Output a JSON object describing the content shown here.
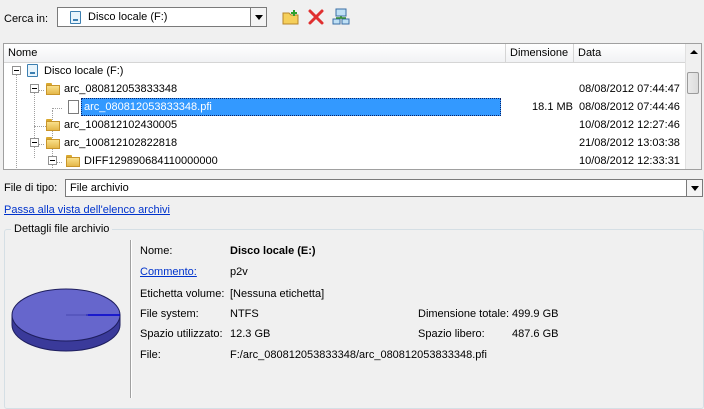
{
  "top": {
    "look_in_label": "Cerca in:",
    "location": "Disco locale (F:)",
    "toolbar": [
      "new-folder-icon",
      "delete-icon",
      "network-icon"
    ]
  },
  "list": {
    "columns": [
      "Nome",
      "Dimensione",
      "Data"
    ],
    "rows": [
      {
        "name": "Disco locale (F:)",
        "size": "",
        "date": "",
        "kind": "drive",
        "selected": false
      },
      {
        "name": "arc_080812053833348",
        "size": "",
        "date": "08/08/2012 07:44:47",
        "kind": "folder",
        "selected": false
      },
      {
        "name": "arc_080812053833348.pfi",
        "size": "18.1 MB",
        "date": "08/08/2012 07:44:46",
        "kind": "file",
        "selected": true
      },
      {
        "name": "arc_100812102430005",
        "size": "",
        "date": "10/08/2012 12:27:46",
        "kind": "folder",
        "selected": false
      },
      {
        "name": "arc_100812102822818",
        "size": "",
        "date": "21/08/2012 13:03:38",
        "kind": "folder",
        "selected": false
      },
      {
        "name": "DIFF129890684110000000",
        "size": "",
        "date": "10/08/2012 12:33:31",
        "kind": "folder",
        "selected": false
      }
    ]
  },
  "file_type": {
    "label": "File di tipo:",
    "value": "File archivio"
  },
  "switch_view_link": "Passa alla vista dell'elenco archivi",
  "details": {
    "group_title": "Dettagli file archivio",
    "name_label": "Nome:",
    "name_value": "Disco locale (E:)",
    "comment_label": "Commento:",
    "comment_value": "p2v",
    "volume_label_label": "Etichetta volume:",
    "volume_label_value": "[Nessuna etichetta]",
    "fs_label": "File system:",
    "fs_value": "NTFS",
    "total_size_label": "Dimensione totale:",
    "total_size_value": "499.9 GB",
    "used_label": "Spazio utilizzato:",
    "used_value": "12.3 GB",
    "free_label": "Spazio libero:",
    "free_value": "487.6 GB",
    "file_label": "File:",
    "file_value": "F:/arc_080812053833348/arc_080812053833348.pfi"
  },
  "colors": {
    "selection": "#3399ff",
    "link": "#0033cc",
    "disk": "#6666cc"
  }
}
